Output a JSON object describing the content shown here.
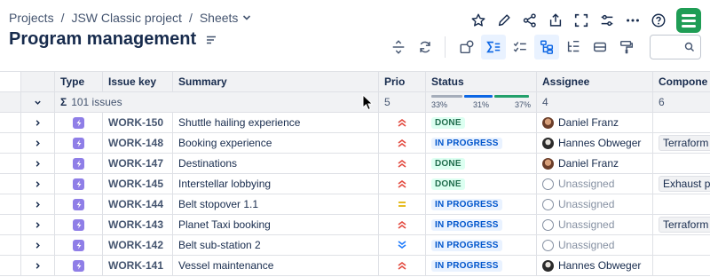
{
  "breadcrumb": {
    "items": [
      "Projects",
      "JSW Classic project",
      "Sheets"
    ],
    "separator": "/"
  },
  "page": {
    "title": "Program management"
  },
  "top_actions": [
    "star-icon",
    "edit-icon",
    "share-icon",
    "export-icon",
    "fullscreen-icon",
    "settings-sliders-icon",
    "more-icon",
    "help-icon",
    "app-logo"
  ],
  "toolbar": {
    "buttons": [
      "row-height-icon",
      "refresh-icon",
      "structure-icon",
      "sum-icon",
      "checklist-icon",
      "hierarchy-icon",
      "tree-icon",
      "card-icon",
      "paint-format-icon"
    ],
    "active": [
      "sum-icon",
      "hierarchy-icon"
    ],
    "search_placeholder": ""
  },
  "table": {
    "columns": [
      "Type",
      "Issue key",
      "Summary",
      "Prio",
      "Status",
      "Assignee",
      "Compone"
    ],
    "summary": {
      "issues_label": "101 issues",
      "prio": "5",
      "status_segments": [
        {
          "label": "33%",
          "fraction": 0.33,
          "color": "#a5adba"
        },
        {
          "label": "31%",
          "fraction": 0.31,
          "color": "#0c66e4"
        },
        {
          "label": "37%",
          "fraction": 0.37,
          "color": "#22a06b"
        }
      ],
      "assignee": "4",
      "component": "6"
    },
    "rows": [
      {
        "key": "WORK-150",
        "summary": "Shuttle hailing experience",
        "prio": "high",
        "status": "DONE",
        "status_type": "done",
        "assignee": "Daniel Franz",
        "avatar": "daniel",
        "component": ""
      },
      {
        "key": "WORK-148",
        "summary": "Booking experience",
        "prio": "high",
        "status": "IN PROGRESS",
        "status_type": "progress",
        "assignee": "Hannes Obweger",
        "avatar": "hannes",
        "component": "Terraform"
      },
      {
        "key": "WORK-147",
        "summary": "Destinations",
        "prio": "high",
        "status": "DONE",
        "status_type": "done",
        "assignee": "Daniel Franz",
        "avatar": "daniel",
        "component": ""
      },
      {
        "key": "WORK-145",
        "summary": "Interstellar lobbying",
        "prio": "high",
        "status": "DONE",
        "status_type": "done",
        "assignee": "Unassigned",
        "avatar": "none",
        "component": "Exhaust p"
      },
      {
        "key": "WORK-144",
        "summary": "Belt stopover 1.1",
        "prio": "medium",
        "status": "IN PROGRESS",
        "status_type": "progress",
        "assignee": "Unassigned",
        "avatar": "none",
        "component": ""
      },
      {
        "key": "WORK-143",
        "summary": "Planet Taxi booking",
        "prio": "high",
        "status": "IN PROGRESS",
        "status_type": "progress",
        "assignee": "Unassigned",
        "avatar": "none",
        "component": "Terraform"
      },
      {
        "key": "WORK-142",
        "summary": "Belt sub-station 2",
        "prio": "low",
        "status": "IN PROGRESS",
        "status_type": "progress",
        "assignee": "Unassigned",
        "avatar": "none",
        "component": ""
      },
      {
        "key": "WORK-141",
        "summary": "Vessel maintenance",
        "prio": "high",
        "status": "IN PROGRESS",
        "status_type": "progress",
        "assignee": "Hannes Obweger",
        "avatar": "hannes",
        "component": ""
      }
    ]
  },
  "colors": {
    "prio_high": "#e2483d",
    "prio_medium": "#e2b203",
    "prio_low": "#1d7afc",
    "accent": "#0c66e4"
  }
}
